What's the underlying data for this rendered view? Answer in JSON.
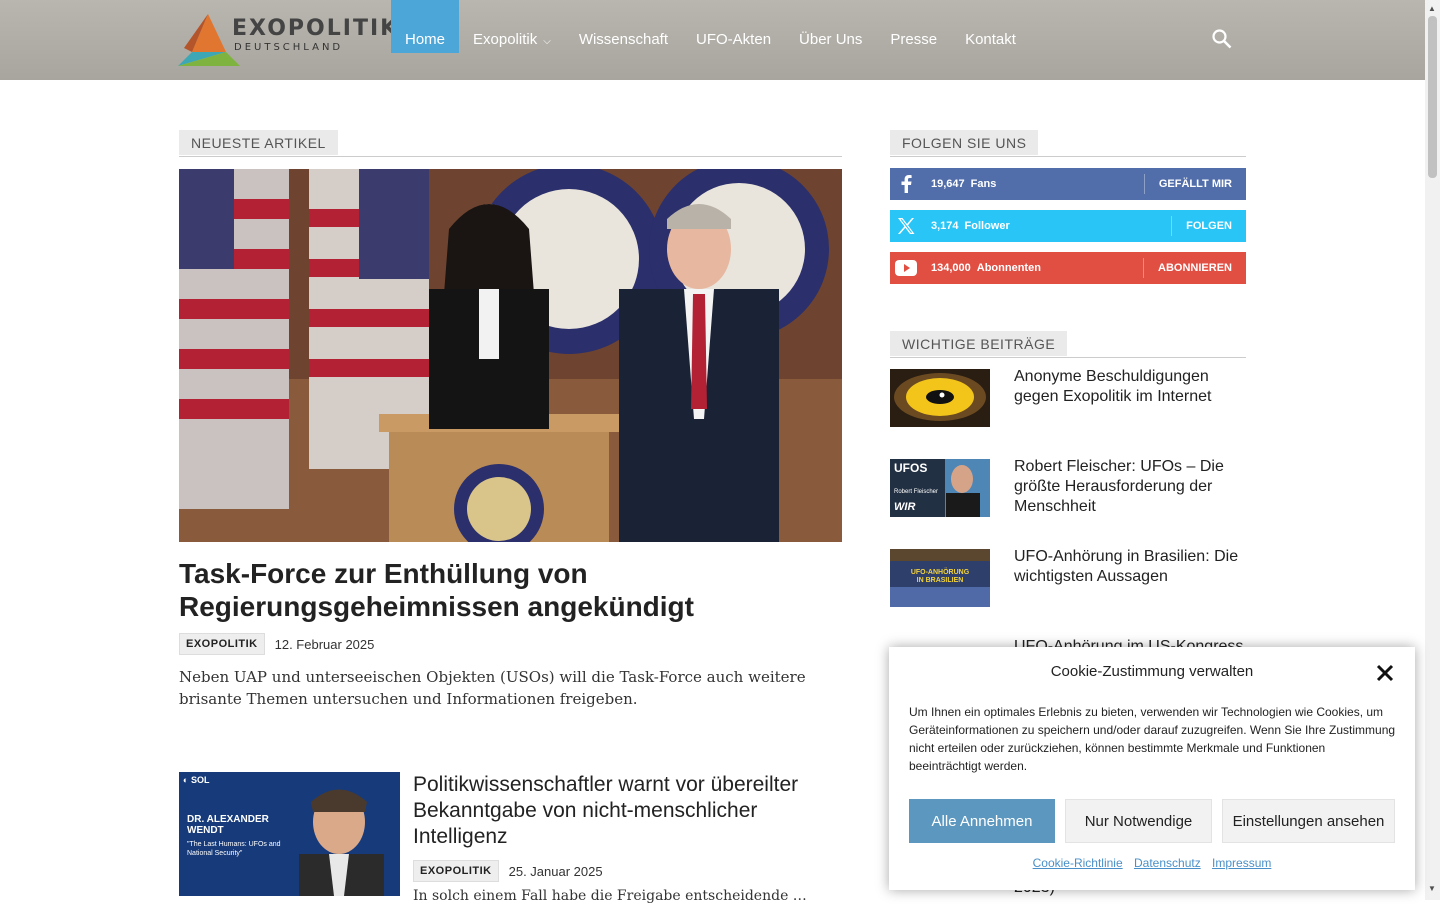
{
  "header": {
    "logo_main": "EXOPOLITIK",
    "logo_sub": "DEUTSCHLAND",
    "nav": [
      {
        "label": "Home",
        "active": true
      },
      {
        "label": "Exopolitik",
        "dropdown": true
      },
      {
        "label": "Wissenschaft"
      },
      {
        "label": "UFO-Akten"
      },
      {
        "label": "Über Uns"
      },
      {
        "label": "Presse"
      },
      {
        "label": "Kontakt"
      }
    ],
    "search_icon": "search-icon",
    "accent": "#4da6d8"
  },
  "main": {
    "section_title": "NEUESTE ARTIKEL",
    "featured": {
      "title": "Task-Force zur Enthüllung von Regierungsgeheimnissen angekündigt",
      "category": "EXOPOLITIK",
      "date": "12. Februar 2025",
      "excerpt": "Neben UAP und unterseeischen Objekten (USOs) will die Task-Force auch weitere brisante Themen untersuchen und Informationen freigeben."
    },
    "second": {
      "title": "Politikwissenschaftler warnt vor übereilter Bekanntgabe von nicht-menschlicher Intelligenz",
      "category": "EXOPOLITIK",
      "date": "25. Januar 2025",
      "excerpt": "In solch einem Fall habe die Freigabe entscheidende …",
      "thumb_brand": "SOL",
      "thumb_name": "DR. ALEXANDER WENDT",
      "thumb_quote": "\"The Last Humans: UFOs and National Security\""
    }
  },
  "sidebar": {
    "follow_title": "FOLGEN SIE UNS",
    "social": [
      {
        "network": "facebook",
        "count": "19,647",
        "label": "Fans",
        "action": "GEFÄLLT MIR",
        "color": "#516eab"
      },
      {
        "network": "x",
        "count": "3,174",
        "label": "Follower",
        "action": "FOLGEN",
        "color": "#29c5f6"
      },
      {
        "network": "youtube",
        "count": "134,000",
        "label": "Abonnenten",
        "action": "ABONNIEREN",
        "color": "#e14e42"
      }
    ],
    "important_title": "WICHTIGE BEITRÄGE",
    "posts": [
      {
        "title": "Anonyme Beschuldigungen gegen Exopolitik im Internet"
      },
      {
        "title": "Robert Fleischer: UFOs – Die größte Herausforderung der Menschheit",
        "thumb_text": "UFOS",
        "thumb_sub": "Robert Fleischer",
        "thumb_brand": "WIR"
      },
      {
        "title": "UFO-Anhörung in Brasilien: Die wichtigsten Aussagen",
        "thumb_text": "UFO-ANHÖRUNG IN BRASILIEN"
      },
      {
        "title": "UFO-Anhörung im US-Kongress"
      }
    ],
    "partial_text": "2023)"
  },
  "cookie": {
    "title": "Cookie-Zustimmung verwalten",
    "message": "Um Ihnen ein optimales Erlebnis zu bieten, verwenden wir Technologien wie Cookies, um Geräteinformationen zu speichern und/oder darauf zuzugreifen. Wenn Sie Ihre Zustimmung nicht erteilen oder zurückziehen, können bestimmte Merkmale und Funktionen beeinträchtigt werden.",
    "accept_all": "Alle Annehmen",
    "necessary_only": "Nur Notwendige",
    "view_settings": "Einstellungen ansehen",
    "links": [
      "Cookie-Richtlinie",
      "Datenschutz",
      "Impressum"
    ],
    "accent": "#5c97bf"
  }
}
